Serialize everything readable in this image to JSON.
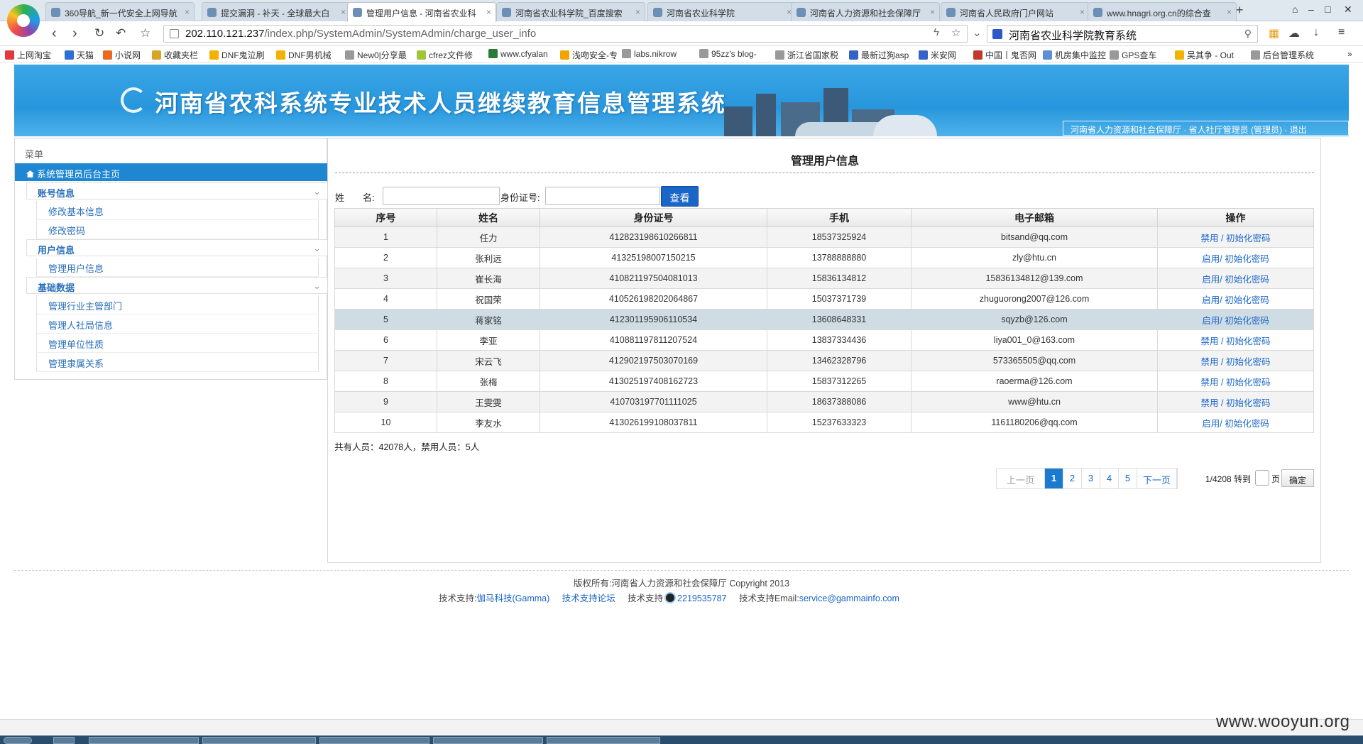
{
  "browser": {
    "tabs": [
      {
        "label": "360导航_新一代安全上网导航",
        "active": false
      },
      {
        "label": "提交漏洞 - 补天 - 全球最大白",
        "active": false
      },
      {
        "label": "管理用户信息 - 河南省农业科",
        "active": true
      },
      {
        "label": "河南省农业科学院_百度搜索",
        "active": false
      },
      {
        "label": "河南省农业科学院",
        "active": false
      },
      {
        "label": "河南省人力资源和社会保障厅",
        "active": false
      },
      {
        "label": "河南省人民政府门户网站",
        "active": false
      },
      {
        "label": "www.hnagri.org.cn的综合查",
        "active": false
      }
    ],
    "new_tab": "+",
    "url_host": "202.110.121.237",
    "url_path": "/index.php/SystemAdmin/SystemAdmin/charge_user_info",
    "search_text": "河南省农业科学院教育系统",
    "favorites": [
      "上网淘宝",
      "天猫",
      "小说网",
      "收藏夹栏",
      "DNF鬼泣刷",
      "DNF男机械",
      "New0|分享最",
      "cfrez文件修",
      "www.cfyalan",
      "浅吻安全-专",
      "labs.nikrow",
      "95zz's blog-",
      "浙江省国家税",
      "最新过狗asp",
      "米安网",
      "中国丨鬼否网",
      "机房集中监控",
      "GPS查车",
      "吴其争 - Out",
      "后台管理系统"
    ]
  },
  "header": {
    "title": "河南省农科系统专业技术人员继续教育信息管理系统",
    "user_info": "河南省人力资源和社会保障厅 · 省人社厅管理员 (管理员) ·",
    "logout": "退出"
  },
  "sidebar": {
    "menu_label": "菜单",
    "home": "系统管理员后台主页",
    "sections": [
      {
        "title": "账号信息",
        "items": [
          "修改基本信息",
          "修改密码"
        ]
      },
      {
        "title": "用户信息",
        "items": [
          "管理用户信息"
        ]
      },
      {
        "title": "基础数据",
        "items": [
          "管理行业主管部门",
          "管理人社局信息",
          "管理单位性质",
          "管理隶属关系"
        ]
      }
    ]
  },
  "main": {
    "title": "管理用户信息",
    "search": {
      "name_label": "姓　　名:",
      "id_label": "身份证号:",
      "button": "查看",
      "name_value": "",
      "id_value": ""
    },
    "columns": [
      "序号",
      "姓名",
      "身份证号",
      "手机",
      "电子邮箱",
      "操作"
    ],
    "rows": [
      {
        "no": "1",
        "name": "任力",
        "id": "412823198610266811",
        "phone": "18537325924",
        "email": "bitsand@qq.com",
        "action1": "禁用",
        "sep": " / ",
        "action2": "初始化密码"
      },
      {
        "no": "2",
        "name": "张利远",
        "id": "41325198007150215",
        "phone": "13788888880",
        "email": "zly@htu.cn",
        "action1": "启用",
        "sep": "/ ",
        "action2": "初始化密码"
      },
      {
        "no": "3",
        "name": "崔长海",
        "id": "410821197504081013",
        "phone": "15836134812",
        "email": "15836134812@139.com",
        "action1": "启用",
        "sep": "/ ",
        "action2": "初始化密码"
      },
      {
        "no": "4",
        "name": "祝国荣",
        "id": "410526198202064867",
        "phone": "15037371739",
        "email": "zhuguorong2007@126.com",
        "action1": "启用",
        "sep": "/ ",
        "action2": "初始化密码"
      },
      {
        "no": "5",
        "name": "蒋家铭",
        "id": "412301195906110534",
        "phone": "13608648331",
        "email": "sqyzb@126.com",
        "action1": "启用",
        "sep": "/ ",
        "action2": "初始化密码"
      },
      {
        "no": "6",
        "name": "李亚",
        "id": "410881197811207524",
        "phone": "13837334436",
        "email": "liya001_0@163.com",
        "action1": "禁用",
        "sep": " / ",
        "action2": "初始化密码"
      },
      {
        "no": "7",
        "name": "宋云飞",
        "id": "412902197503070169",
        "phone": "13462328796",
        "email": "573365505@qq.com",
        "action1": "禁用",
        "sep": " / ",
        "action2": "初始化密码"
      },
      {
        "no": "8",
        "name": "张梅",
        "id": "413025197408162723",
        "phone": "15837312265",
        "email": "raoerma@126.com",
        "action1": "禁用",
        "sep": " / ",
        "action2": "初始化密码"
      },
      {
        "no": "9",
        "name": "王雯雯",
        "id": "410703197701111025",
        "phone": "18637388086",
        "email": "www@htu.cn",
        "action1": "禁用",
        "sep": " / ",
        "action2": "初始化密码"
      },
      {
        "no": "10",
        "name": "李友水",
        "id": "413026199108037811",
        "phone": "15237633323",
        "email": "1161180206@qq.com",
        "action1": "启用",
        "sep": "/ ",
        "action2": "初始化密码"
      }
    ],
    "summary": "共有人员：42078人，禁用人员：5人",
    "pager": {
      "prev": "上一页",
      "pages": [
        "1",
        "2",
        "3",
        "4",
        "5"
      ],
      "current": "1",
      "next": "下一页",
      "info": "1/4208 转到",
      "unit": "页",
      "go": "确定"
    }
  },
  "footer": {
    "copyright": "版权所有:河南省人力资源和社会保障厅 Copyright 2013",
    "support1_label": "技术支持:",
    "support1_link": "伽马科技(Gamma)",
    "support2_link": "技术支持论坛",
    "support3_label": "技术支持",
    "support3_qq": "2219535787",
    "support4_label": "技术支持Email:",
    "support4_link": "service@gammainfo.com"
  },
  "watermark": "www.wooyun.org",
  "colors": {
    "accent": "#1f87d2",
    "link": "#1a66c8",
    "banner": "#2896dd",
    "highlight_row": "#cfdce4"
  }
}
